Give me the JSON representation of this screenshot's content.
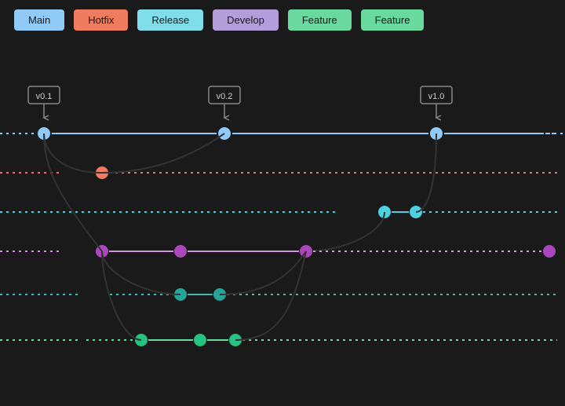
{
  "branches": [
    {
      "id": "main",
      "label": "Main",
      "class": "label-main"
    },
    {
      "id": "hotfix",
      "label": "Hotfix",
      "class": "label-hotfix"
    },
    {
      "id": "release",
      "label": "Release",
      "class": "label-release"
    },
    {
      "id": "develop",
      "label": "Develop",
      "class": "label-develop"
    },
    {
      "id": "feature1",
      "label": "Feature",
      "class": "label-feature1"
    },
    {
      "id": "feature2",
      "label": "Feature",
      "class": "label-feature2"
    }
  ],
  "tags": [
    {
      "id": "v0.1",
      "label": "v0.1"
    },
    {
      "id": "v0.2",
      "label": "v0.2"
    },
    {
      "id": "v1.0",
      "label": "v1.0"
    }
  ]
}
